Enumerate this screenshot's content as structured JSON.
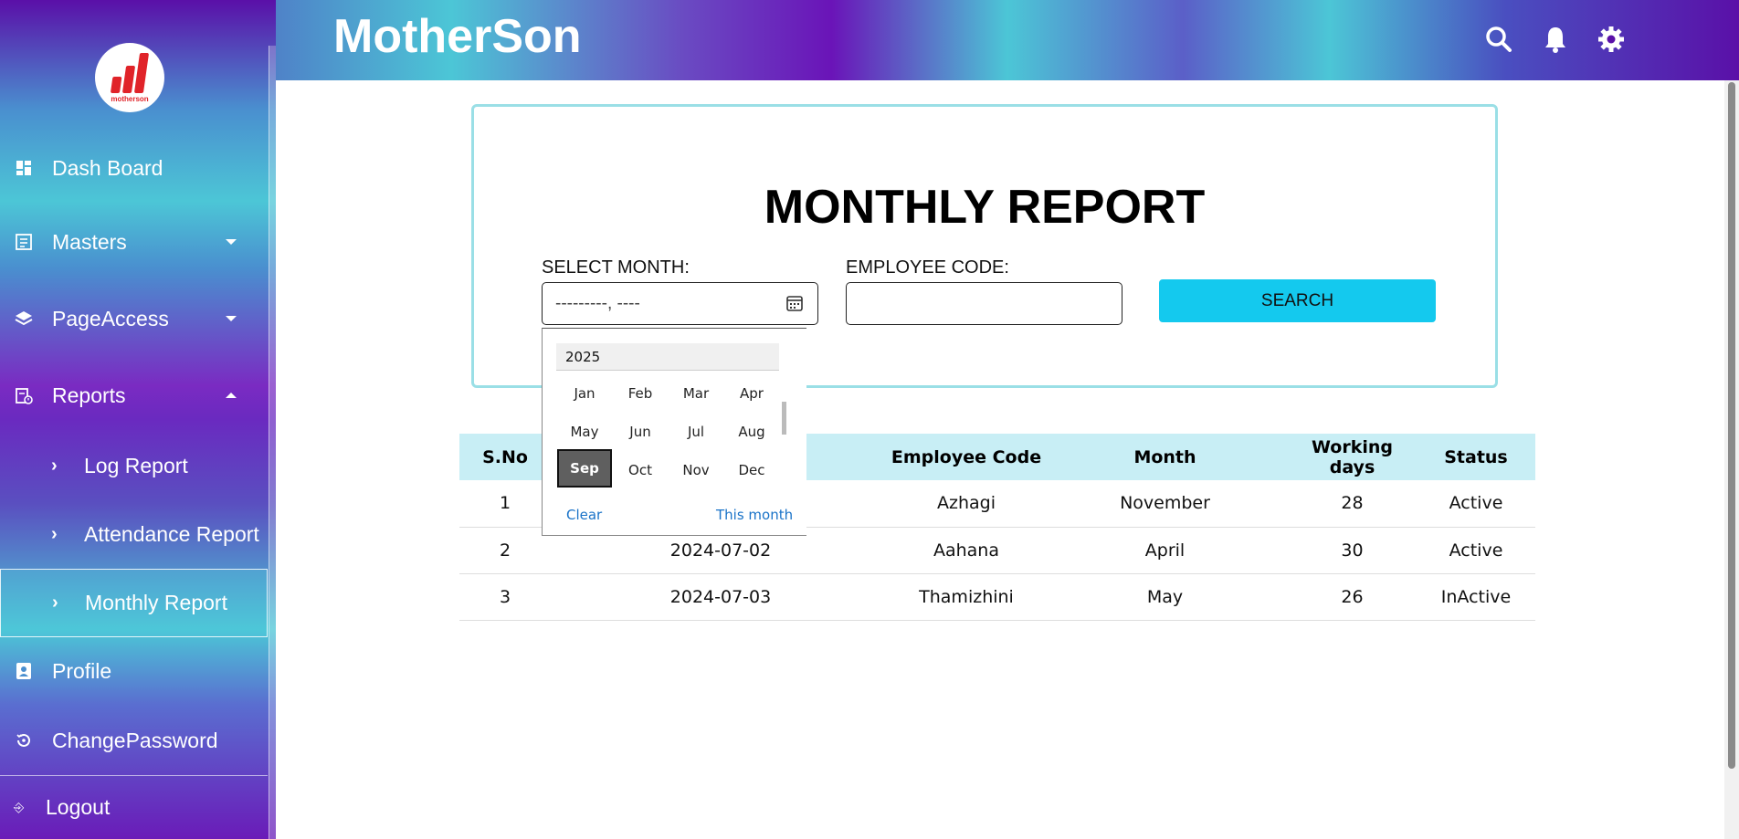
{
  "sidebar": {
    "logo_text": "motherson",
    "items": [
      {
        "label": "Dash Board"
      },
      {
        "label": "Masters"
      },
      {
        "label": "PageAccess"
      },
      {
        "label": "Reports"
      },
      {
        "label": "Profile"
      },
      {
        "label": "ChangePassword"
      }
    ],
    "sub_items": [
      {
        "label": "Log Report"
      },
      {
        "label": "Attendance Report"
      },
      {
        "label": "Monthly Report"
      }
    ],
    "logout_label": "Logout"
  },
  "header": {
    "brand": "MotherSon",
    "icons": [
      "search-icon",
      "bell-icon",
      "gear-icon"
    ]
  },
  "report": {
    "title": "MONTHLY REPORT",
    "select_month_label": "SELECT MONTH:",
    "month_value": "---------, ----",
    "employee_code_label": "EMPLOYEE CODE:",
    "employee_code_value": "",
    "search_label": "SEARCH"
  },
  "picker": {
    "year": "2025",
    "months": [
      "Jan",
      "Feb",
      "Mar",
      "Apr",
      "May",
      "Jun",
      "Jul",
      "Aug",
      "Sep",
      "Oct",
      "Nov",
      "Dec"
    ],
    "selected": "Sep",
    "clear_label": "Clear",
    "this_month_label": "This month"
  },
  "table": {
    "headers": [
      "S.No",
      "",
      "Employee Code",
      "Month",
      "Working days",
      "Status"
    ],
    "rows": [
      [
        "1",
        "",
        "Azhagi",
        "November",
        "28",
        "Active"
      ],
      [
        "2",
        "2024-07-02",
        "Aahana",
        "April",
        "30",
        "Active"
      ],
      [
        "3",
        "2024-07-03",
        "Thamizhini",
        "May",
        "26",
        "InActive"
      ]
    ]
  },
  "colors": {
    "accent": "#14c9ee",
    "card_border": "#9adfe6",
    "table_header_bg": "#c8eef5",
    "selected_month_bg": "#5f5f5f"
  }
}
